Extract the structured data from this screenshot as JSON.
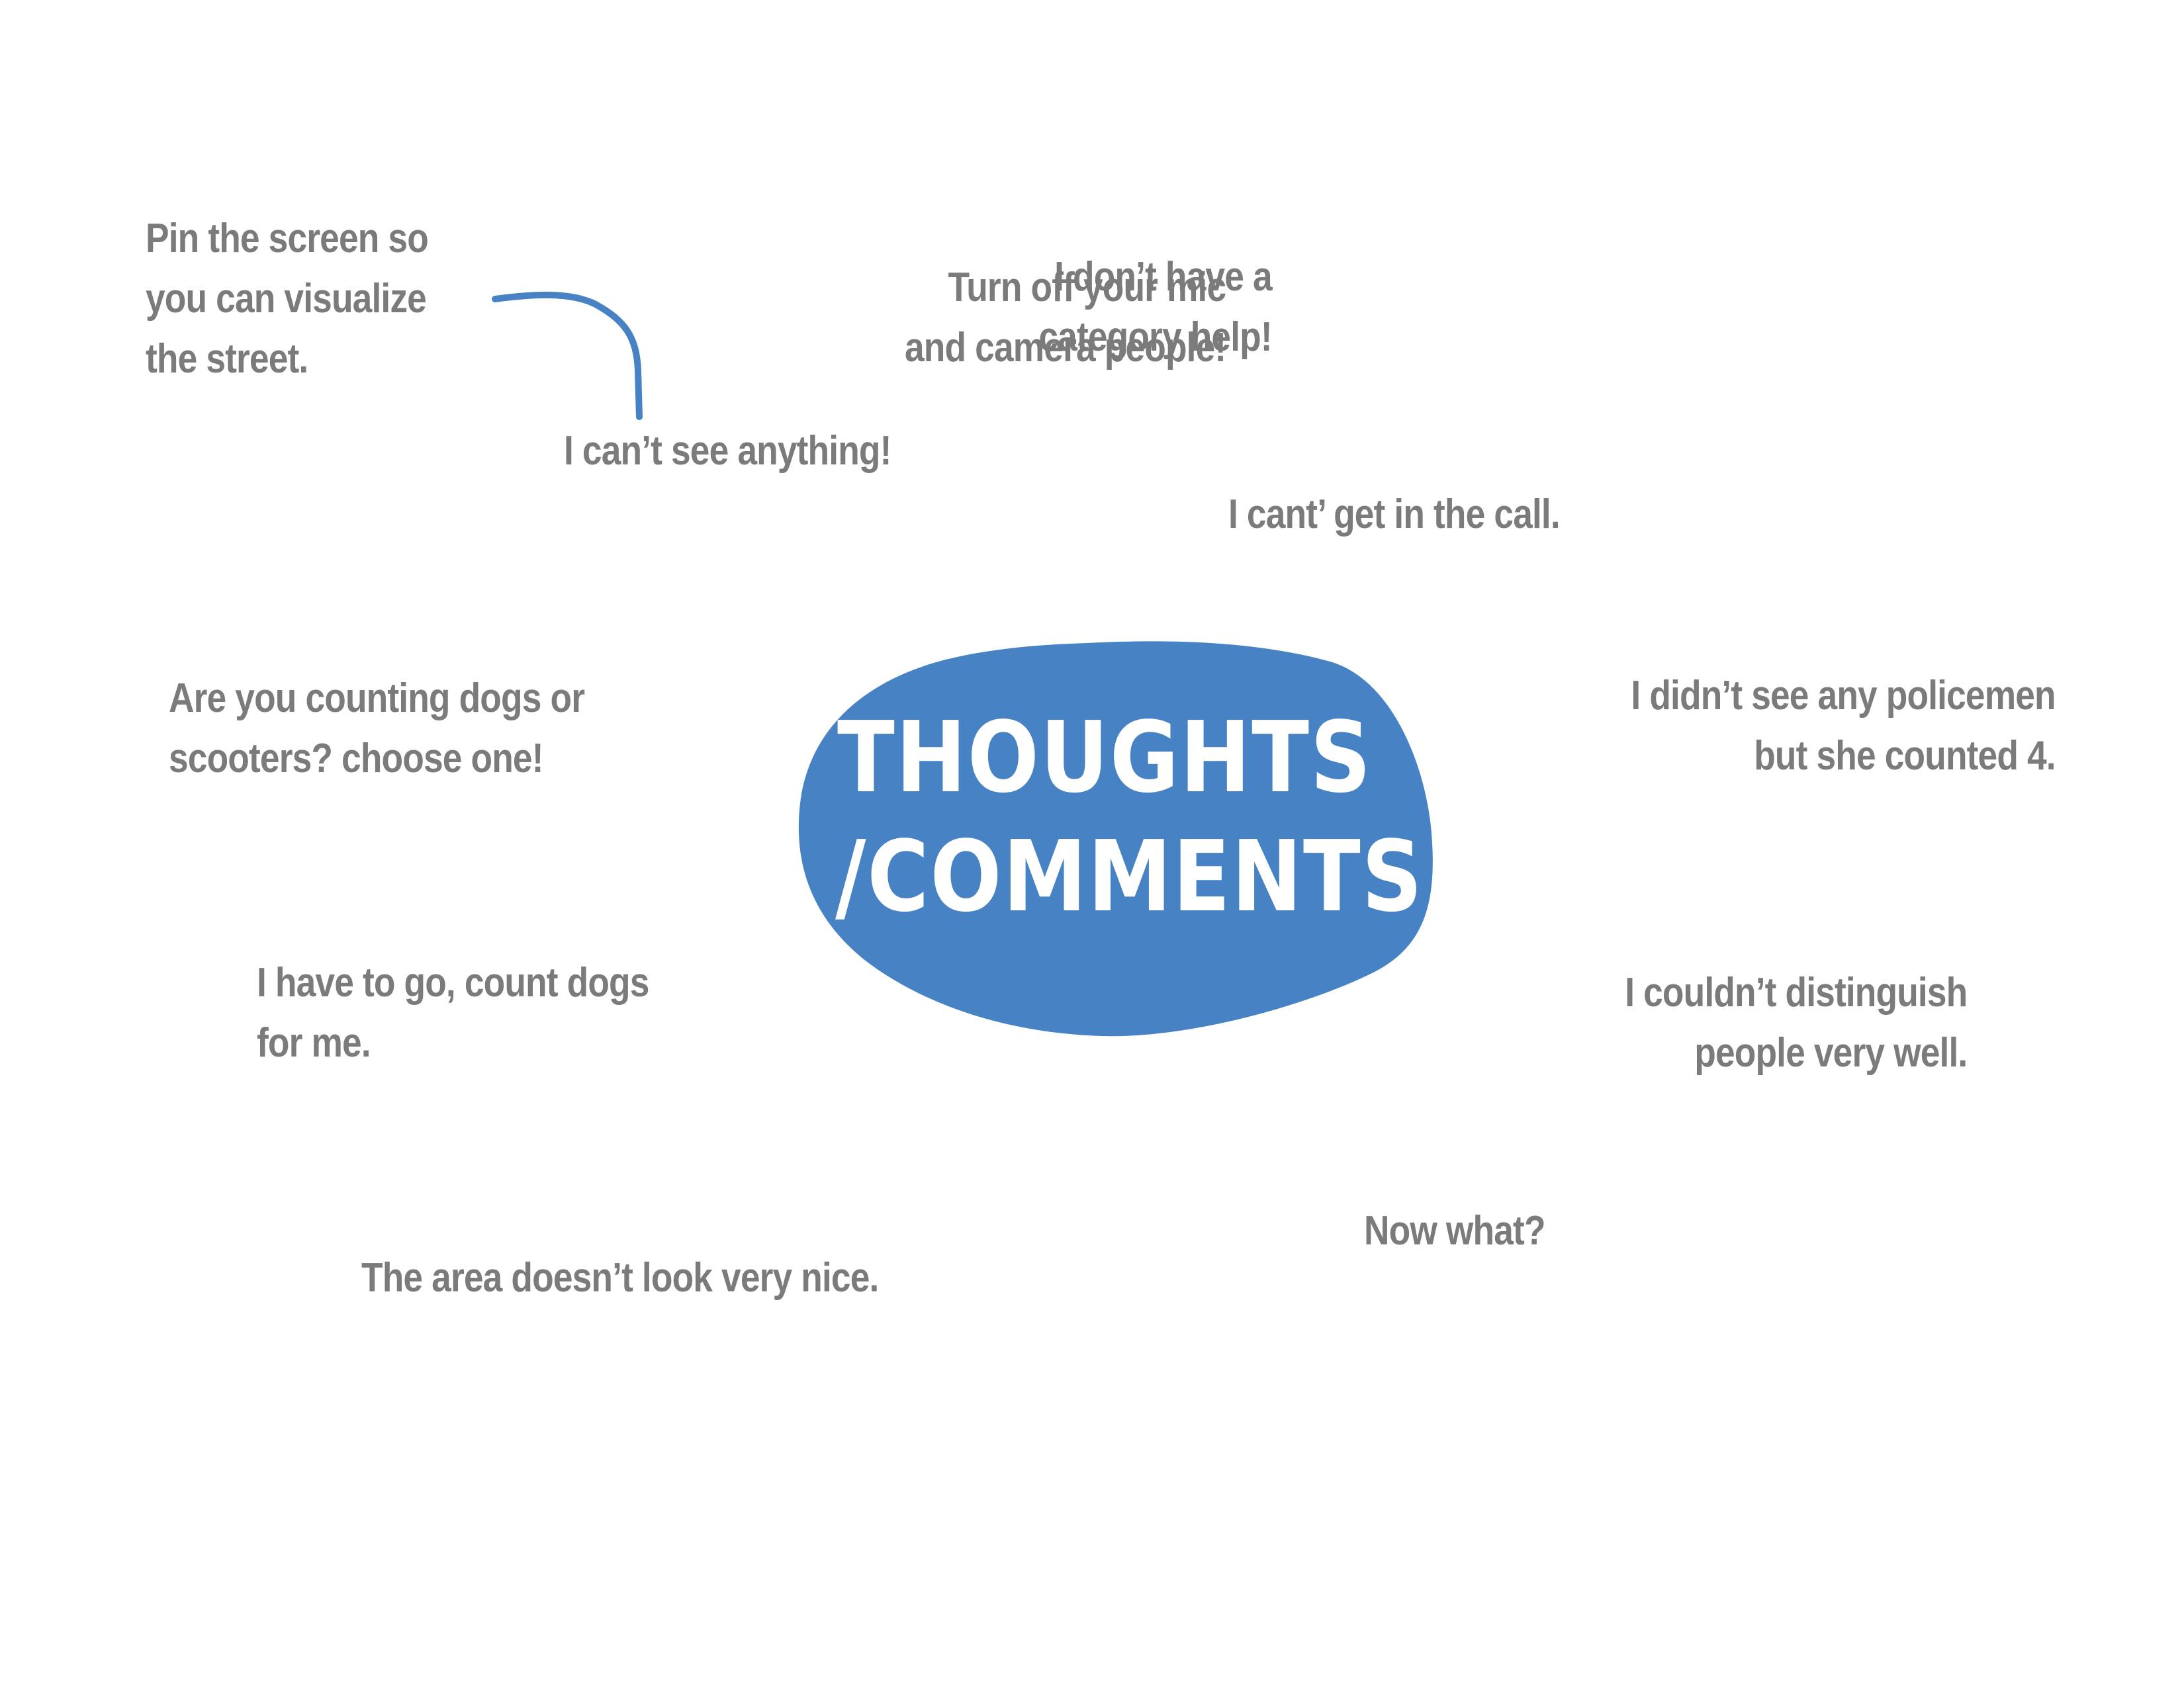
{
  "colors": {
    "accent": "#4682c4",
    "note_text": "#7b7b7b",
    "title_text": "#ffffff",
    "background": "#ffffff"
  },
  "center": {
    "line1": "THOUGHTS",
    "line2": "/COMMENTS"
  },
  "notes": {
    "pin_screen": "Pin the screen so\nyou can visualize\nthe street.",
    "cant_see": "I can’t see anything!",
    "no_category": "I don’t have a\ncategory help!",
    "turn_off_mic": "Turn off your mic\nand camera people!",
    "cant_get_in": "I cant’ get in the call.",
    "dogs_or_scooters": "Are you counting dogs or\nscooters? choose one!",
    "policemen": "I didn’t see any policemen\nbut she counted 4.",
    "have_to_go": "I have to go, count dogs\nfor me.",
    "distinguish": "I couldn’t distinguish\npeople very well.",
    "now_what": "Now what?",
    "area_nice": "The area doesn’t look very nice."
  }
}
